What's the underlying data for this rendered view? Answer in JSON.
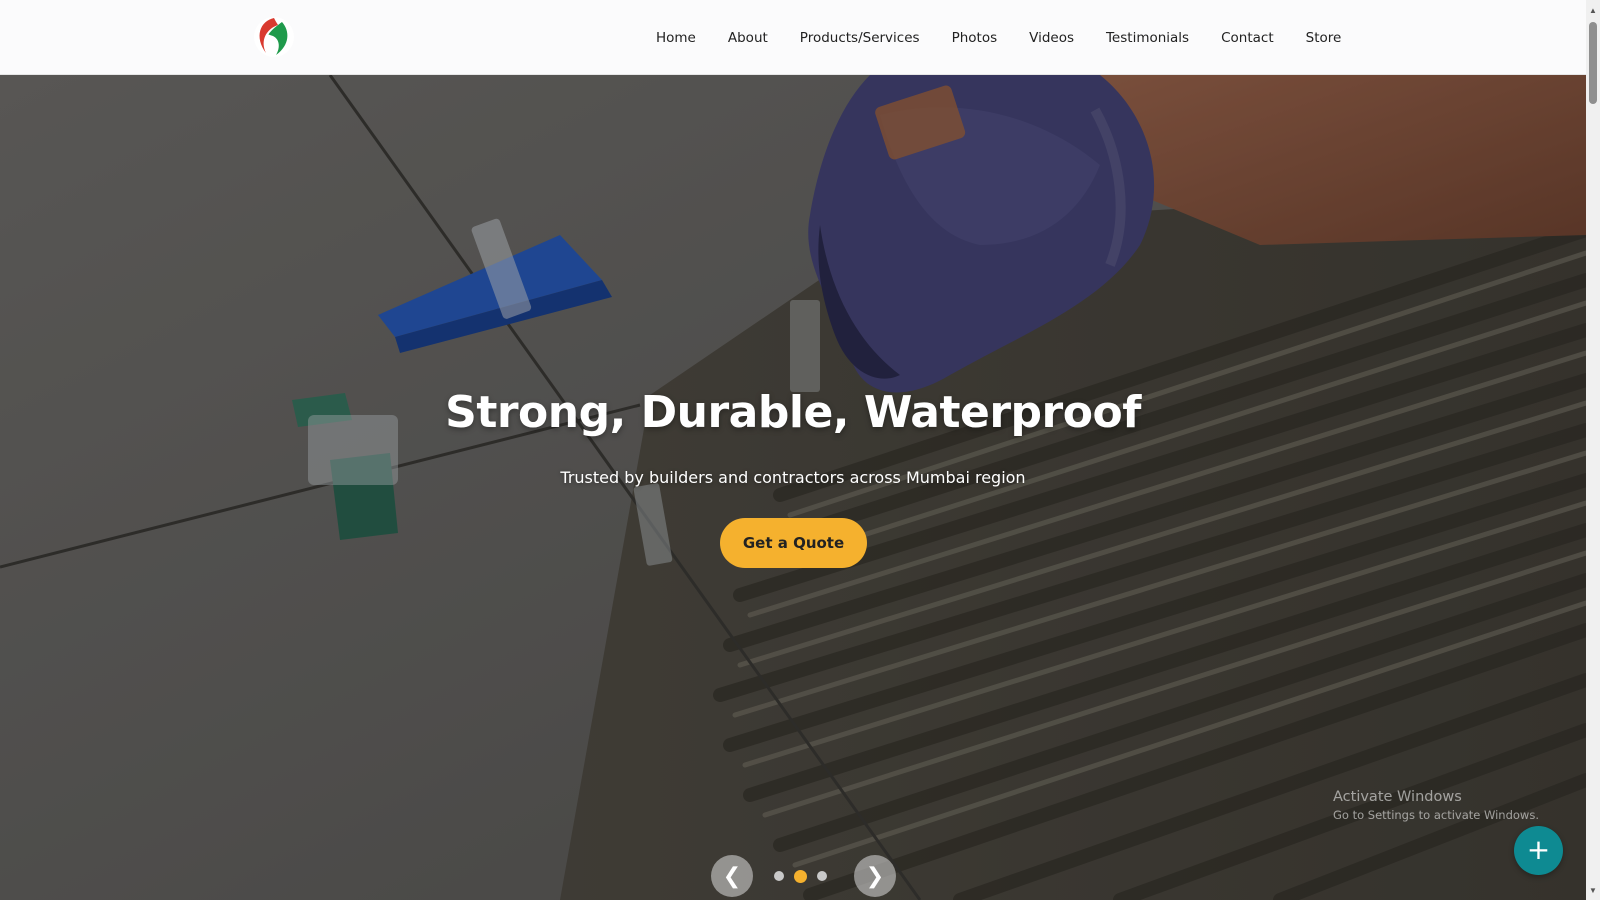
{
  "header": {
    "logo_icon": "green-red-leaf-logo",
    "nav": [
      {
        "label": "Home"
      },
      {
        "label": "About"
      },
      {
        "label": "Products/Services"
      },
      {
        "label": "Photos"
      },
      {
        "label": "Videos"
      },
      {
        "label": "Testimonials"
      },
      {
        "label": "Contact"
      },
      {
        "label": "Store"
      }
    ]
  },
  "hero": {
    "title": "Strong, Durable, Waterproof",
    "subtitle": "Trusted by builders and contractors across Mumbai region",
    "cta_label": "Get a Quote",
    "prev_icon": "chevron-left-icon",
    "next_icon": "chevron-right-icon",
    "prev_glyph": "❮",
    "next_glyph": "❯",
    "slide_count": 3,
    "active_slide": 2,
    "accent_color": "#f5b12e"
  },
  "watermark": {
    "line1": "Activate Windows",
    "line2": "Go to Settings to activate Windows."
  },
  "fab": {
    "icon": "plus-icon",
    "glyph": "+",
    "color": "#0e8a92"
  }
}
